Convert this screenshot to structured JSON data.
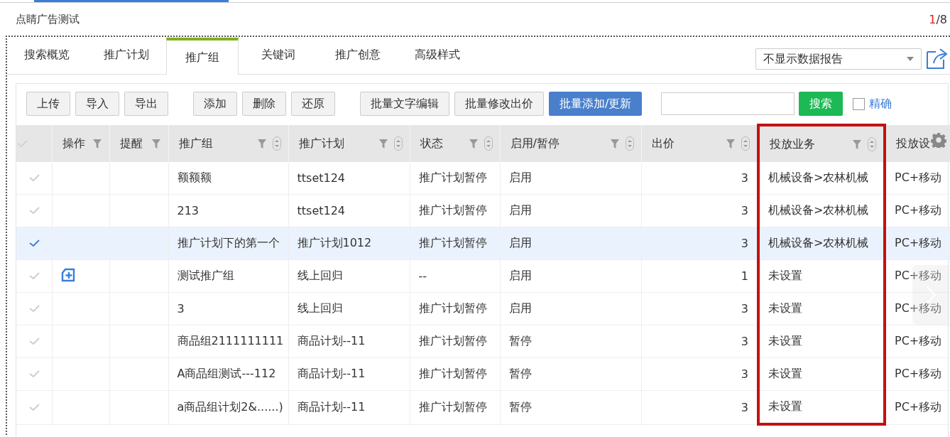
{
  "page_title": "点睛广告测试",
  "pager": {
    "current": "1",
    "rest": "/8"
  },
  "tabs": [
    {
      "label": "搜索概览",
      "selected": false
    },
    {
      "label": "推广计划",
      "selected": false
    },
    {
      "label": "推广组",
      "selected": true
    },
    {
      "label": "关键词",
      "selected": false
    },
    {
      "label": "推广创意",
      "selected": false
    },
    {
      "label": "高级样式",
      "selected": false
    }
  ],
  "report_select": {
    "value": "不显示数据报告"
  },
  "toolbar": {
    "groups": [
      [
        {
          "label": "上传",
          "kind": "default"
        },
        {
          "label": "导入",
          "kind": "default"
        },
        {
          "label": "导出",
          "kind": "default"
        }
      ],
      [
        {
          "label": "添加",
          "kind": "default"
        },
        {
          "label": "删除",
          "kind": "default"
        },
        {
          "label": "还原",
          "kind": "default"
        }
      ],
      [
        {
          "label": "批量文字编辑",
          "kind": "default"
        },
        {
          "label": "批量修改出价",
          "kind": "default"
        },
        {
          "label": "批量添加/更新",
          "kind": "primary"
        }
      ]
    ],
    "search_button": "搜索",
    "exact": {
      "label": "精确",
      "checked": false
    }
  },
  "table": {
    "columns": [
      {
        "label": "操作",
        "filter": true,
        "sort": false,
        "highlighted": false
      },
      {
        "label": "提醒",
        "filter": true,
        "sort": false,
        "highlighted": false
      },
      {
        "label": "推广组",
        "filter": true,
        "sort": true,
        "highlighted": false
      },
      {
        "label": "推广计划",
        "filter": true,
        "sort": true,
        "highlighted": false
      },
      {
        "label": "状态",
        "filter": true,
        "sort": true,
        "highlighted": false
      },
      {
        "label": "启用/暂停",
        "filter": true,
        "sort": true,
        "highlighted": false
      },
      {
        "label": "出价",
        "filter": true,
        "sort": true,
        "highlighted": false
      },
      {
        "label": "投放业务",
        "filter": true,
        "sort": true,
        "highlighted": true
      },
      {
        "label": "投放设",
        "filter": false,
        "sort": false,
        "highlighted": false
      }
    ],
    "rows": [
      {
        "selected": false,
        "add_icon": false,
        "cells": [
          "",
          "",
          "额额额",
          "ttset124",
          "推广计划暂停",
          "启用",
          "3",
          "机械设备>农林机械",
          "PC+移动"
        ]
      },
      {
        "selected": false,
        "add_icon": false,
        "cells": [
          "",
          "",
          "213",
          "ttset124",
          "推广计划暂停",
          "启用",
          "3",
          "机械设备>农林机械",
          "PC+移动"
        ]
      },
      {
        "selected": true,
        "add_icon": false,
        "cells": [
          "",
          "",
          "推广计划下的第一个",
          "推广计划1012",
          "推广计划暂停",
          "启用",
          "3",
          "机械设备>农林机械",
          "PC+移动"
        ]
      },
      {
        "selected": false,
        "add_icon": true,
        "cells": [
          "",
          "",
          "测试推广组",
          "线上回归",
          "--",
          "启用",
          "1",
          "未设置",
          "PC+移动"
        ]
      },
      {
        "selected": false,
        "add_icon": false,
        "cells": [
          "",
          "",
          "3",
          "线上回归",
          "推广计划暂停",
          "启用",
          "3",
          "未设置",
          "PC+移动"
        ]
      },
      {
        "selected": false,
        "add_icon": false,
        "cells": [
          "",
          "",
          "商品组2111111111",
          "商品计划--11",
          "推广计划暂停",
          "暂停",
          "3",
          "未设置",
          "PC+移动"
        ]
      },
      {
        "selected": false,
        "add_icon": false,
        "cells": [
          "",
          "",
          "A商品组测试---112",
          "商品计划--11",
          "推广计划暂停",
          "暂停",
          "3",
          "未设置",
          "PC+移动"
        ]
      },
      {
        "selected": false,
        "add_icon": false,
        "cells": [
          "",
          "",
          "a商品组计划2&......)",
          "商品计划--11",
          "推广计划暂停",
          "暂停",
          "3",
          "未设置",
          "PC+移动"
        ]
      }
    ]
  }
}
